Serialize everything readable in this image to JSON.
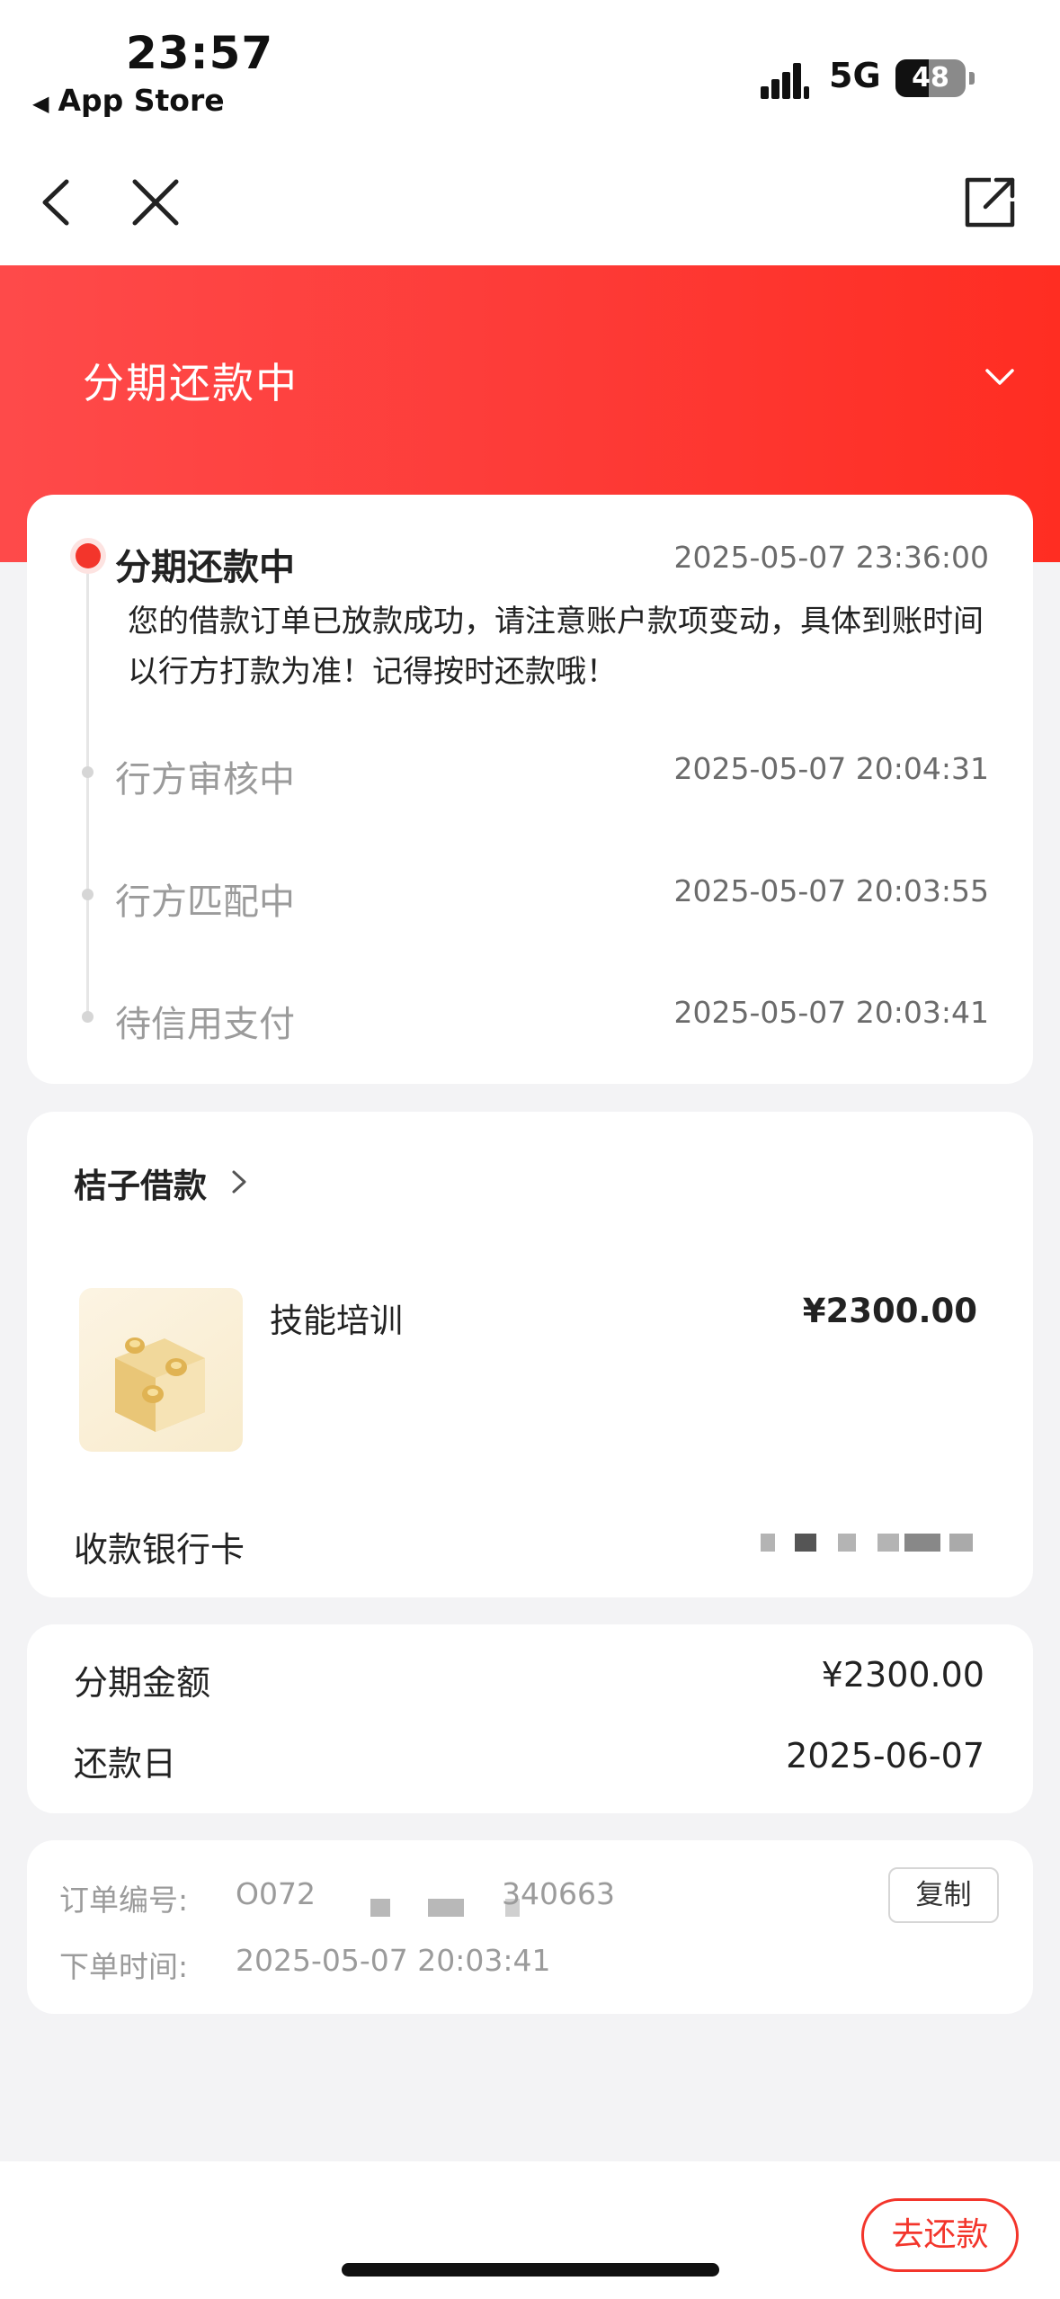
{
  "status_bar": {
    "time": "23:57",
    "back_app": "App Store",
    "network": "5G",
    "battery": "48"
  },
  "header": {
    "status_title": "分期还款中"
  },
  "timeline": [
    {
      "title": "分期还款中",
      "time": "2025-05-07 23:36:00",
      "active": true,
      "description": "您的借款订单已放款成功，请注意账户款项变动，具体到账时间以行方打款为准！记得按时还款哦！"
    },
    {
      "title": "行方审核中",
      "time": "2025-05-07 20:04:31",
      "active": false
    },
    {
      "title": "行方匹配中",
      "time": "2025-05-07 20:03:55",
      "active": false
    },
    {
      "title": "待信用支付",
      "time": "2025-05-07 20:03:41",
      "active": false
    }
  ],
  "loan": {
    "provider": "桔子借款",
    "product_name": "技能培训",
    "product_price": "¥2300.00",
    "bank_card_label": "收款银行卡"
  },
  "installment": {
    "amount_label": "分期金额",
    "amount_value": "¥2300.00",
    "due_label": "还款日",
    "due_value": "2025-06-07"
  },
  "order": {
    "number_label": "订单编号:",
    "number_prefix": "O072",
    "number_suffix": "340663",
    "time_label": "下单时间:",
    "time_value": "2025-05-07 20:03:41",
    "copy_label": "复制"
  },
  "footer": {
    "repay_label": "去还款"
  },
  "colors": {
    "accent": "#f3352b",
    "header_gradient_start": "#fe4a4a",
    "header_gradient_end": "#ff2d22",
    "background": "#f3f3f5"
  },
  "icons": [
    "back-arrow-icon",
    "close-icon",
    "share-icon",
    "chevron-down-icon",
    "chevron-right-icon",
    "coin-box-icon"
  ]
}
